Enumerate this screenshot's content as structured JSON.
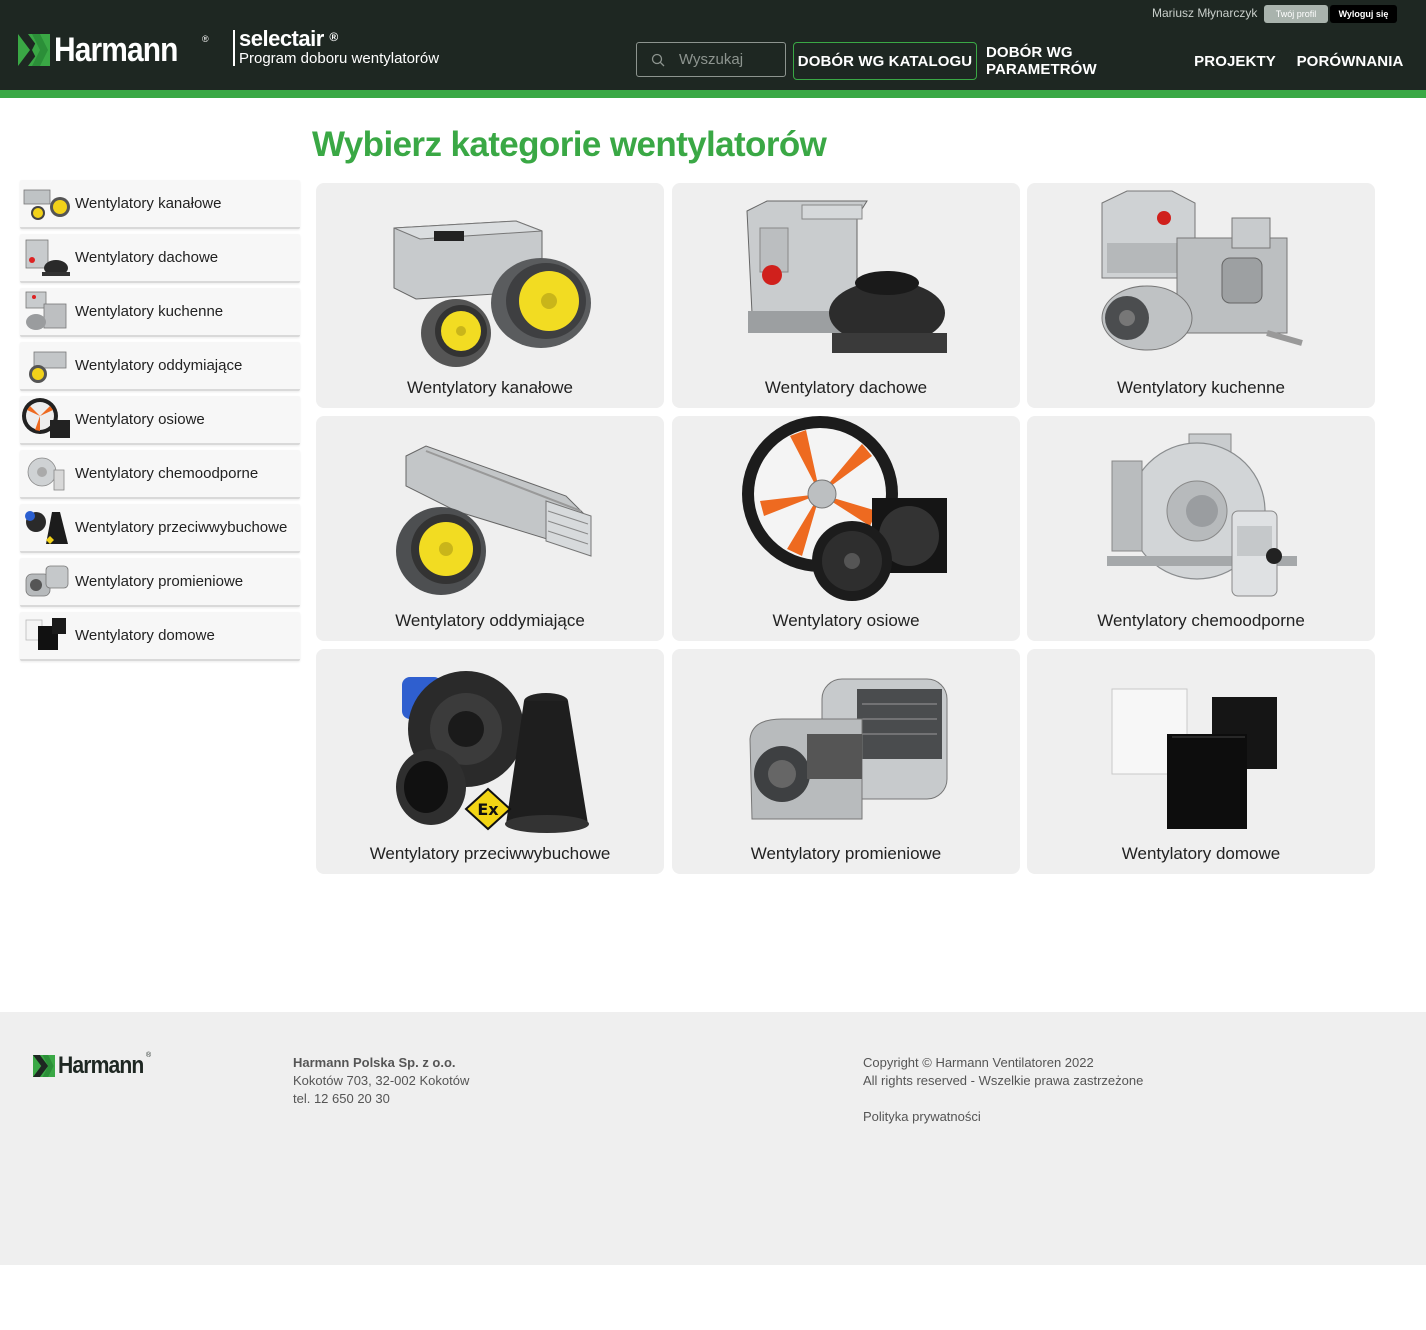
{
  "header": {
    "brand": "Harmann",
    "brand_reg": "®",
    "product_name": "selectair",
    "product_reg": "®",
    "product_subtitle": "Program doboru wentylatorów",
    "user_name": "Mariusz Młynarczyk",
    "profile_button": "Twój profil",
    "logout_button": "Wyloguj się",
    "search_placeholder": "Wyszukaj",
    "nav": [
      {
        "label": "DOBÓR WG KATALOGU",
        "active": true
      },
      {
        "label": "DOBÓR WG PARAMETRÓW",
        "active": false
      },
      {
        "label": "PROJEKTY",
        "active": false
      },
      {
        "label": "PORÓWNANIA",
        "active": false
      }
    ],
    "accent_color": "#3aa845",
    "bg_color": "#1e2722"
  },
  "main": {
    "title": "Wybierz kategorie wentylatorów"
  },
  "categories": [
    {
      "label": "Wentylatory kanałowe",
      "icon": "duct-fan-icon"
    },
    {
      "label": "Wentylatory dachowe",
      "icon": "roof-fan-icon"
    },
    {
      "label": "Wentylatory kuchenne",
      "icon": "kitchen-fan-icon"
    },
    {
      "label": "Wentylatory oddymiające",
      "icon": "smoke-exhaust-fan-icon"
    },
    {
      "label": "Wentylatory osiowe",
      "icon": "axial-fan-icon"
    },
    {
      "label": "Wentylatory chemoodporne",
      "icon": "chemical-resistant-fan-icon"
    },
    {
      "label": "Wentylatory przeciwwybuchowe",
      "icon": "explosion-proof-fan-icon"
    },
    {
      "label": "Wentylatory promieniowe",
      "icon": "centrifugal-fan-icon"
    },
    {
      "label": "Wentylatory domowe",
      "icon": "household-fan-icon"
    }
  ],
  "footer": {
    "brand": "Harmann",
    "brand_reg": "®",
    "company": "Harmann Polska Sp. z o.o.",
    "address": "Kokotów 703, 32-002 Kokotów",
    "phone": "tel. 12 650 20 30",
    "copyright": "Copyright © Harmann Ventilatoren 2022",
    "rights": "All rights reserved - Wszelkie prawa zastrzeżone",
    "privacy": "Polityka prywatności"
  }
}
